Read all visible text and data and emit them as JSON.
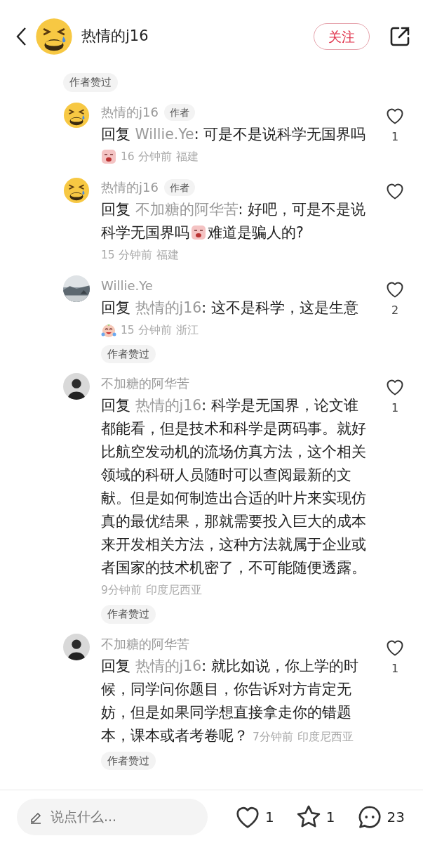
{
  "header": {
    "user_name": "热情的j16",
    "follow_label": "关注"
  },
  "top_chip": "作者赞过",
  "comments": [
    {
      "avatar": {
        "kind": "emoji"
      },
      "name": "热情的j16",
      "author_badge": "作者",
      "reply_word": "回复",
      "reply_to": "Willie.Ye",
      "body": [
        {
          "kind": "text",
          "text": ": 可是不是说科学无国界吗"
        }
      ],
      "meta_sticker": {
        "kind": "crying"
      },
      "time": "16 分钟前",
      "location": "福建",
      "likes": "1"
    },
    {
      "avatar": {
        "kind": "emoji"
      },
      "name": "热情的j16",
      "author_badge": "作者",
      "reply_word": "回复",
      "reply_to": "不加糖的阿华苦",
      "body": [
        {
          "kind": "text",
          "text": ": 好吧，可是不是说科学无国界吗"
        },
        {
          "kind": "sticker"
        },
        {
          "kind": "text",
          "text": "难道是骗人的?"
        }
      ],
      "time": "15 分钟前",
      "location": "福建"
    },
    {
      "name": "Willie.Ye",
      "reply_word": "回复",
      "reply_to": "热情的j16",
      "body": [
        {
          "kind": "text",
          "text": ": 这不是科学，这是生意"
        }
      ],
      "meta_sticker": {
        "kind": "laughing"
      },
      "time": "15 分钟前",
      "location": "浙江",
      "liked_chip": "作者赞过",
      "likes": "2"
    },
    {
      "avatar": {
        "kind": "person"
      },
      "name": "不加糖的阿华苦",
      "reply_word": "回复",
      "reply_to": "热情的j16",
      "body": [
        {
          "kind": "text",
          "text": ": 科学是无国界，论文谁都能看，但是技术和科学是两码事。就好比航空发动机的流场仿真方法，这个相关领域的科研人员随时可以查阅最新的文献。但是如何制造出合适的叶片来实现仿真的最优结果，那就需要投入巨大的成本来开发相关方法，这种方法就属于企业或者国家的技术机密了，不可能随便透露。"
        }
      ],
      "time": "9分钟前",
      "location": "印度尼西亚",
      "liked_chip": "作者赞过",
      "likes": "1"
    },
    {
      "avatar": {
        "kind": "person"
      },
      "name": "不加糖的阿华苦",
      "reply_word": "回复",
      "reply_to": "热情的j16",
      "body": [
        {
          "kind": "text",
          "text": ": 就比如说，你上学的时候，同学问你题目，你告诉对方肯定无妨，但是如果同学想直接拿走你的错题本，课本或者考卷呢？"
        }
      ],
      "time": "7分钟前",
      "location": "印度尼西亚",
      "meta_inline": true,
      "liked_chip": "作者赞过",
      "likes": "1"
    }
  ],
  "bottom_bar": {
    "placeholder": "说点什么...",
    "likes": "1",
    "favorites": "1",
    "comments": "23"
  }
}
